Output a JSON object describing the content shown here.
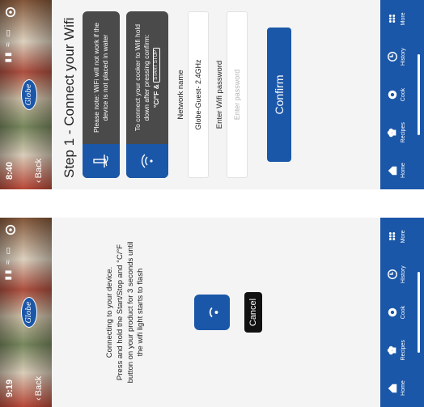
{
  "screens": [
    {
      "status_time": "8:40",
      "back_label": "Back",
      "logo_text": "Globe",
      "title": "Step 1 - Connect your Wifi",
      "notice_water": "Please note: WiFi will not work if the device is not placed in water",
      "notice_hold_prefix": "To connect your cooker to Wifi hold down after pressing confirm:",
      "notice_hold_keys": "°C/°F  &",
      "notice_hold_key_badge": "START STOP",
      "network_label": "Network name",
      "network_value": "Globe-Guest- 2.4GHz",
      "password_label": "Enter Wifi password",
      "password_placeholder": "Enter password",
      "confirm_label": "Confirm"
    },
    {
      "status_time": "9:19",
      "back_label": "Back",
      "logo_text": "Globe",
      "connecting_line1": "Connecting to your device.",
      "connecting_line2": "Press and hold the Start/Stop and °C/°F button on your product for 3 seconds until the wifi light starts to flash",
      "cancel_label": "Cancel"
    }
  ],
  "tabbar": {
    "items": [
      {
        "label": "Home",
        "icon": "home-icon"
      },
      {
        "label": "Recipes",
        "icon": "chef-hat-icon"
      },
      {
        "label": "Cook",
        "icon": "pot-icon"
      },
      {
        "label": "History",
        "icon": "clock-icon"
      },
      {
        "label": "More",
        "icon": "dots-icon"
      }
    ]
  },
  "colors": {
    "brand_blue": "#1b57a8",
    "card_gray": "#4a4a4a",
    "cancel_black": "#111111"
  }
}
